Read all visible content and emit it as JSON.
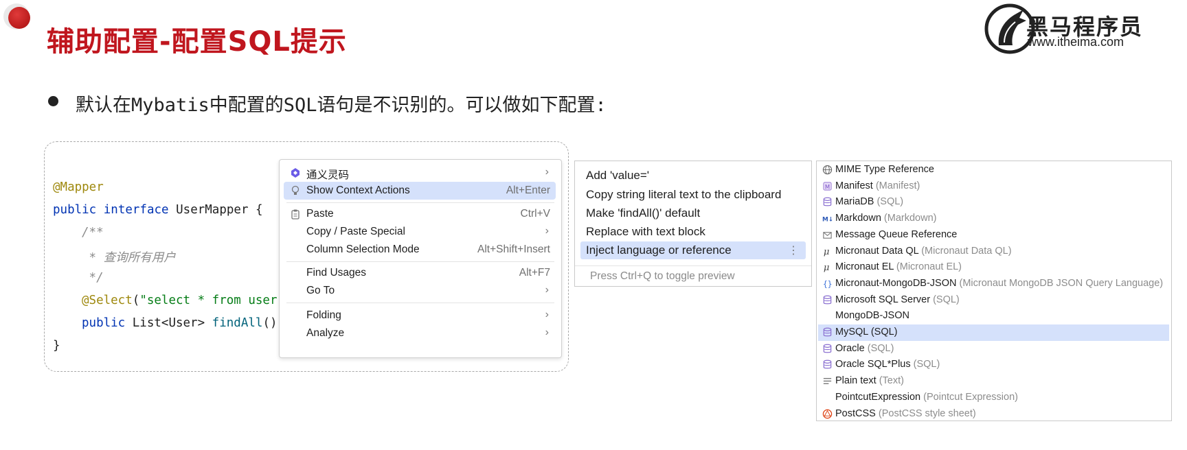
{
  "header": {
    "title": "辅助配置-配置SQL提示",
    "brand_name": "黑马程序员",
    "brand_url": "www.itheima.com"
  },
  "bullet": {
    "text": "默认在Mybatis中配置的SQL语句是不识别的。可以做如下配置:"
  },
  "code": {
    "line1": "@Mapper",
    "line2_kw": "public interface ",
    "line2_name": "UserMapper {",
    "line3": "/**",
    "line4": " * 查询所有用户",
    "line5": " */",
    "line6_ann": "@Select",
    "line6_paren": "(",
    "line6_str": "\"select * from user",
    "line7_kw": "public ",
    "line7_type": "List<User> ",
    "line7_fn": "findAll",
    "line7_rest": "()",
    "line8": "}"
  },
  "context_menu": {
    "items": [
      {
        "label": "通义灵码",
        "shortcut": "",
        "submenu": true,
        "icon": "ai-assistant-icon"
      },
      {
        "label": "Show Context Actions",
        "shortcut": "Alt+Enter",
        "submenu": false,
        "icon": "lightbulb-icon",
        "selected": true
      },
      {
        "label": "Paste",
        "shortcut": "Ctrl+V",
        "submenu": false,
        "icon": "clipboard-icon"
      },
      {
        "label": "Copy / Paste Special",
        "shortcut": "",
        "submenu": true
      },
      {
        "label": "Column Selection Mode",
        "shortcut": "Alt+Shift+Insert",
        "submenu": false
      },
      {
        "label": "Find Usages",
        "shortcut": "Alt+F7",
        "submenu": false
      },
      {
        "label": "Go To",
        "shortcut": "",
        "submenu": true
      },
      {
        "label": "Folding",
        "shortcut": "",
        "submenu": true
      },
      {
        "label": "Analyze",
        "shortcut": "",
        "submenu": true
      }
    ],
    "submenu_arrow": "›"
  },
  "intentions": {
    "items": [
      {
        "label": "Add 'value='"
      },
      {
        "label": "Copy string literal text to the clipboard"
      },
      {
        "label": "Make 'findAll()' default"
      },
      {
        "label": "Replace with text block"
      },
      {
        "label": "Inject language or reference",
        "selected": true
      }
    ],
    "kebab": "⋮",
    "hint": "Press Ctrl+Q to toggle preview"
  },
  "languages": {
    "items": [
      {
        "name": "MIME Type Reference",
        "sub": "",
        "icon": "globe-icon"
      },
      {
        "name": "Manifest",
        "sub": "(Manifest)",
        "icon": "manifest-icon"
      },
      {
        "name": "MariaDB",
        "sub": "(SQL)",
        "icon": "database-icon"
      },
      {
        "name": "Markdown",
        "sub": "(Markdown)",
        "icon": "markdown-icon"
      },
      {
        "name": "Message Queue Reference",
        "sub": "",
        "icon": "message-queue-icon"
      },
      {
        "name": "Micronaut Data QL",
        "sub": "(Micronaut Data QL)",
        "icon": "micronaut-icon"
      },
      {
        "name": "Micronaut EL",
        "sub": "(Micronaut EL)",
        "icon": "micronaut-icon"
      },
      {
        "name": "Micronaut-MongoDB-JSON",
        "sub": "(Micronaut MongoDB JSON Query Language)",
        "icon": "json-braces-icon"
      },
      {
        "name": "Microsoft SQL Server",
        "sub": "(SQL)",
        "icon": "database-icon"
      },
      {
        "name": "MongoDB-JSON",
        "sub": "",
        "icon": ""
      },
      {
        "name": "MySQL",
        "sub": "(SQL)",
        "icon": "database-icon",
        "selected": true
      },
      {
        "name": "Oracle",
        "sub": "(SQL)",
        "icon": "database-icon"
      },
      {
        "name": "Oracle SQL*Plus",
        "sub": "(SQL)",
        "icon": "database-icon"
      },
      {
        "name": "Plain text",
        "sub": "(Text)",
        "icon": "text-lines-icon"
      },
      {
        "name": "PointcutExpression",
        "sub": "(Pointcut Expression)",
        "icon": ""
      },
      {
        "name": "PostCSS",
        "sub": "(PostCSS style sheet)",
        "icon": "postcss-icon"
      }
    ]
  },
  "colors": {
    "title_red": "#c0161e",
    "selection_blue": "#d5e1fb",
    "db_icon": "#8a6fd1"
  }
}
